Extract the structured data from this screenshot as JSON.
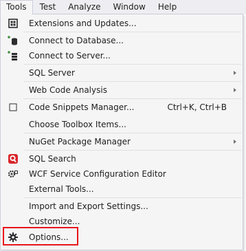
{
  "menubar": {
    "items": [
      {
        "label": "Tools",
        "active": true
      },
      {
        "label": "Test"
      },
      {
        "label": "Analyze"
      },
      {
        "label": "Window"
      },
      {
        "label": "Help"
      }
    ]
  },
  "menu": {
    "items": [
      {
        "name": "extensions-and-updates",
        "label": "Extensions and Updates...",
        "icon": "extensions-icon"
      },
      {
        "name": "connect-to-database",
        "label": "Connect to Database...",
        "icon": "database-add-icon"
      },
      {
        "name": "connect-to-server",
        "label": "Connect to Server...",
        "icon": "server-add-icon"
      },
      {
        "name": "sql-server",
        "label": "SQL Server",
        "submenu": true
      },
      {
        "name": "web-code-analysis",
        "label": "Web Code Analysis",
        "submenu": true
      },
      {
        "name": "code-snippets-manager",
        "label": "Code Snippets Manager...",
        "icon": "snippet-icon",
        "shortcut": "Ctrl+K, Ctrl+B"
      },
      {
        "name": "choose-toolbox-items",
        "label": "Choose Toolbox Items..."
      },
      {
        "name": "nuget-package-manager",
        "label": "NuGet Package Manager",
        "submenu": true
      },
      {
        "name": "sql-search",
        "label": "SQL Search",
        "icon": "sql-search-icon"
      },
      {
        "name": "wcf-service-configuration-editor",
        "label": "WCF Service Configuration Editor",
        "icon": "wcf-config-icon"
      },
      {
        "name": "external-tools",
        "label": "External Tools..."
      },
      {
        "name": "import-export-settings",
        "label": "Import and Export Settings..."
      },
      {
        "name": "customize",
        "label": "Customize..."
      },
      {
        "name": "options",
        "label": "Options...",
        "icon": "gear-icon",
        "highlighted": true
      }
    ]
  },
  "colors": {
    "menu_bg": "#f5f5f5",
    "menubar_bg": "#eeeef2",
    "border": "#cccedb",
    "highlight_outline": "#e8141b",
    "sql_search_red": "#d9262a"
  }
}
